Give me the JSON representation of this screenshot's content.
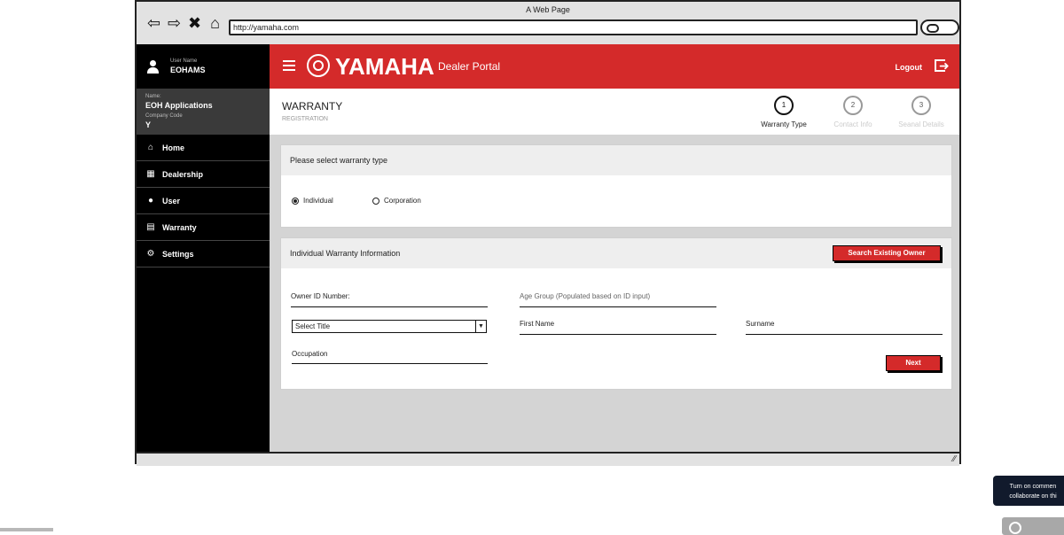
{
  "window": {
    "title": "A Web Page",
    "url": "http://yamaha.com"
  },
  "sidebar": {
    "user_label": "User Name",
    "user_name": "EOHAMS",
    "name_label": "Name:",
    "name_value": "EOH Applications",
    "company_label": "Company Code",
    "company_value": "Y",
    "items": [
      {
        "label": "Home",
        "icon": "home-icon"
      },
      {
        "label": "Dealership",
        "icon": "building-icon"
      },
      {
        "label": "User",
        "icon": "user-icon"
      },
      {
        "label": "Warranty",
        "icon": "document-icon"
      },
      {
        "label": "Settings",
        "icon": "gear-icon"
      }
    ]
  },
  "topbar": {
    "brand": "YAMAHA",
    "portal": "Dealer Portal",
    "logout": "Logout",
    "color": "#d42a2a"
  },
  "header": {
    "title": "WARRANTY",
    "subtitle": "REGISTRATION",
    "steps": [
      {
        "num": "1",
        "label": "Warranty Type",
        "active": true
      },
      {
        "num": "2",
        "label": "Contact Info",
        "active": false
      },
      {
        "num": "3",
        "label": "Seanal Details",
        "active": false
      }
    ]
  },
  "warranty_type": {
    "heading": "Please select warranty type",
    "options": [
      {
        "label": "Individual",
        "selected": true
      },
      {
        "label": "Corporation",
        "selected": false
      }
    ]
  },
  "individual_info": {
    "heading": "Individual Warranty Information",
    "search_button": "Search Existing Owner",
    "owner_id_label": "Owner ID Number:",
    "age_group_label": "Age Group (Populated based on ID input)",
    "title_select": "Select Title",
    "first_name_label": "First Name",
    "surname_label": "Surname",
    "occupation_label": "Occupation",
    "next_button": "Next"
  },
  "overlay": {
    "comment_line1": "Turn on commen",
    "comment_line2": "collaborate on thi"
  }
}
